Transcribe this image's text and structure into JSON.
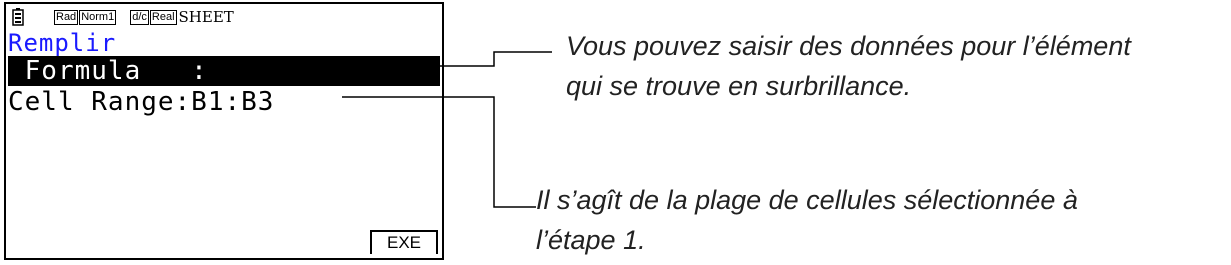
{
  "screen": {
    "status_bar": {
      "battery_icon": "battery-icon",
      "badges": [
        "Rad",
        "Norm1",
        "d/c",
        "Real"
      ],
      "mode_label": "SHEET"
    },
    "title": "Remplir",
    "rows": [
      {
        "text": " Formula   :",
        "highlighted": true
      },
      {
        "text": "Cell Range:B1:B3",
        "highlighted": false
      }
    ],
    "function_key": "EXE"
  },
  "annotations": {
    "top": {
      "line1": "Vous pouvez saisir des données pour l’élément",
      "line2": "qui se trouve en surbrillance."
    },
    "bottom": {
      "line1": "Il s’agît de la plage de cellules sélectionnée à",
      "line2": "l’étape 1."
    }
  },
  "colors": {
    "title_text": "#1a1aff",
    "highlight_bg": "#000000",
    "highlight_text": "#ffffff"
  }
}
